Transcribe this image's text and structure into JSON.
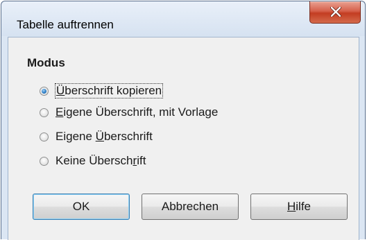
{
  "window": {
    "title": "Tabelle auftrennen"
  },
  "mode": {
    "label": "Modus",
    "options": [
      {
        "pre": "",
        "acc": "Ü",
        "post": "berschrift kopieren",
        "checked": true
      },
      {
        "pre": "",
        "acc": "E",
        "post": "igene Überschrift, mit Vorlage",
        "checked": false
      },
      {
        "pre": "Eigene ",
        "acc": "Ü",
        "post": "berschrift",
        "checked": false
      },
      {
        "pre": "Keine Übersch",
        "acc": "r",
        "post": "ift",
        "checked": false
      }
    ]
  },
  "buttons": {
    "ok": "OK",
    "cancel": "Abbrechen",
    "help_acc": "H",
    "help_rest": "ilfe"
  },
  "colors": {
    "close_button": "#c33d22",
    "selected_radio": "#2f7fc6",
    "default_button_border": "#3c7fb1"
  }
}
